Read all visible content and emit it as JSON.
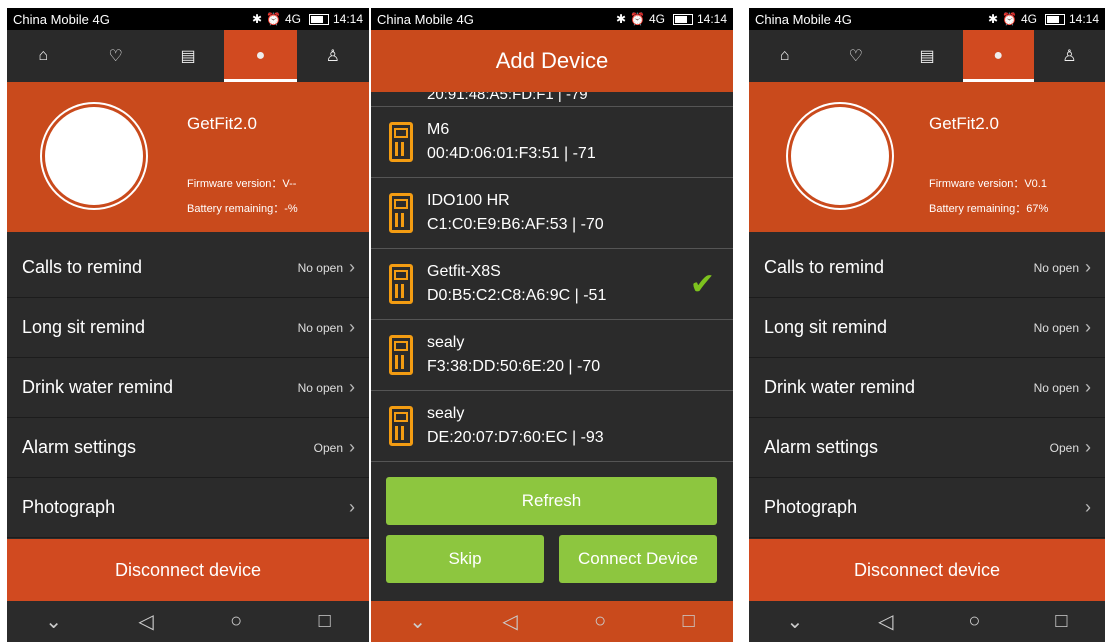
{
  "status": {
    "carrier": "China Mobile 4G",
    "network": "4G",
    "time": "14:14"
  },
  "left": {
    "device_name": "GetFit2.0",
    "firmware": "Firmware version：V--",
    "battery": "Battery remaining：-%",
    "rows": [
      {
        "label": "Calls to remind",
        "value": "No open"
      },
      {
        "label": "Long sit remind",
        "value": "No open"
      },
      {
        "label": "Drink water remind",
        "value": "No open"
      },
      {
        "label": "Alarm settings",
        "value": "Open"
      },
      {
        "label": "Photograph",
        "value": ""
      }
    ],
    "disconnect": "Disconnect device"
  },
  "middle": {
    "title": "Add Device",
    "partial_item": "20:91:48:A5:FD:F1  |  -79",
    "devices": [
      {
        "name": "M6",
        "detail": "00:4D:06:01:F3:51  |  -71"
      },
      {
        "name": "IDO100 HR",
        "detail": "C1:C0:E9:B6:AF:53  |  -70"
      },
      {
        "name": "Getfit-X8S",
        "detail": "D0:B5:C2:C8:A6:9C  |  -51",
        "selected": true
      },
      {
        "name": "sealy",
        "detail": "F3:38:DD:50:6E:20  |  -70"
      },
      {
        "name": "sealy",
        "detail": "DE:20:07:D7:60:EC  |  -93"
      }
    ],
    "refresh": "Refresh",
    "skip": "Skip",
    "connect": "Connect Device"
  },
  "right": {
    "device_name": "GetFit2.0",
    "firmware": "Firmware version：V0.1",
    "battery": "Battery remaining：67%",
    "rows": [
      {
        "label": "Calls to remind",
        "value": "No open"
      },
      {
        "label": "Long sit remind",
        "value": "No open"
      },
      {
        "label": "Drink water remind",
        "value": "No open"
      },
      {
        "label": "Alarm settings",
        "value": "Open"
      },
      {
        "label": "Photograph",
        "value": ""
      }
    ],
    "disconnect": "Disconnect device"
  },
  "nav_icons": [
    "chevron-down-icon",
    "back-icon",
    "home-circle-icon",
    "recent-apps-icon"
  ],
  "tab_icons": [
    "home-icon",
    "heart-rate-icon",
    "document-icon",
    "device-icon",
    "profile-icon"
  ],
  "colors": {
    "accent": "#c94a1c",
    "green": "#8dc63f",
    "dark": "#2b2b2b"
  }
}
